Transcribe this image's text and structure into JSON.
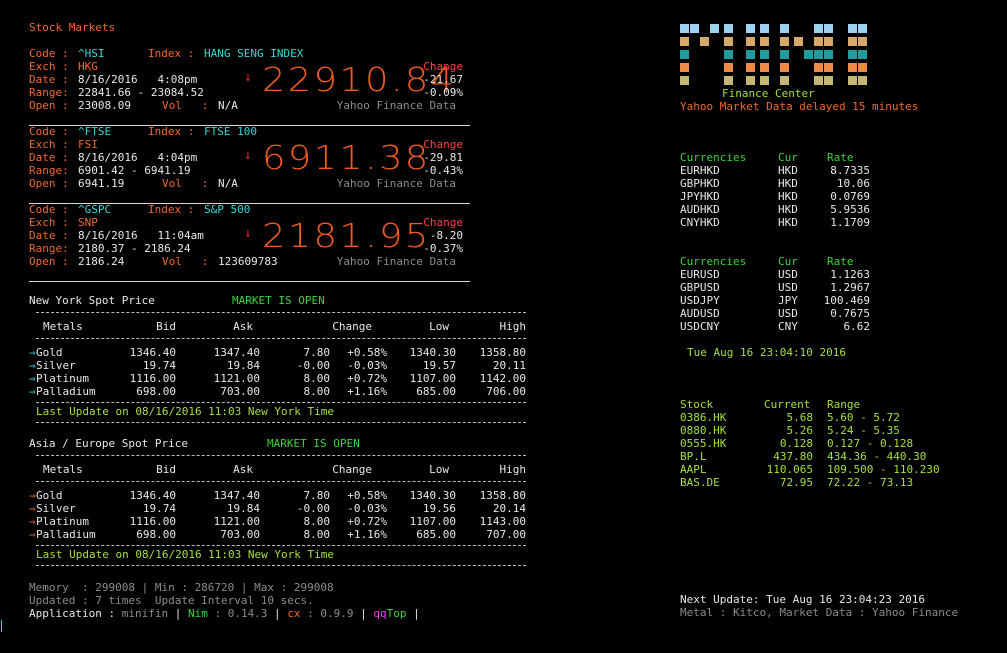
{
  "title": "Stock Markets",
  "indices": [
    {
      "code": "^HSI",
      "index": "HANG SENG INDEX",
      "exch": "HKG",
      "date": "8/16/2016   4:08pm",
      "range": "22841.66 - 23084.52",
      "open": "23008.09",
      "vol": "N/A",
      "change_label": "Change",
      "change": "-21.67",
      "change_pct": "-0.09%",
      "price": "22910.84",
      "source": "Yahoo Finance Data"
    },
    {
      "code": "^FTSE",
      "index": "FTSE 100",
      "exch": "FSI",
      "date": "8/16/2016   4:04pm",
      "range": "6901.42 - 6941.19",
      "open": "6941.19",
      "vol": "N/A",
      "change_label": "Change",
      "change": "-29.81",
      "change_pct": "-0.43%",
      "price": "6911.38",
      "source": "Yahoo Finance Data"
    },
    {
      "code": "^GSPC",
      "index": "S&P 500",
      "exch": "SNP",
      "date": "8/16/2016   11:04am",
      "range": "2180.37 - 2186.24",
      "open": "2186.24",
      "vol": "123609783",
      "change_label": "Change",
      "change": "-8.20",
      "change_pct": "-0.37%",
      "price": "2181.95",
      "source": "Yahoo Finance Data"
    }
  ],
  "labels": {
    "code": "Code : ",
    "index": "Index : ",
    "exch": "Exch : ",
    "date": "Date : ",
    "range": "Range: ",
    "open": "Open : ",
    "vol": "Vol   : ",
    "arrow": "↓"
  },
  "metals_header": [
    "Metals",
    "Bid",
    "Ask",
    "Change",
    "Low",
    "High"
  ],
  "ny": {
    "title": "New York Spot Price",
    "status": "MARKET IS OPEN",
    "rows": [
      [
        "Gold",
        "1346.40",
        "1347.40",
        "7.80",
        "+0.58%",
        "1340.30",
        "1358.80"
      ],
      [
        "Silver",
        "19.74",
        "19.84",
        "-0.00",
        "-0.03%",
        "19.57",
        "20.11"
      ],
      [
        "Platinum",
        "1116.00",
        "1121.00",
        "8.00",
        "+0.72%",
        "1107.00",
        "1142.00"
      ],
      [
        "Palladium",
        "698.00",
        "703.00",
        "8.00",
        "+1.16%",
        "685.00",
        "706.00"
      ]
    ],
    "update": "Last Update on 08/16/2016 11:03 New York Time"
  },
  "asia": {
    "title": "Asia / Europe Spot Price",
    "status": "MARKET IS OPEN",
    "rows": [
      [
        "Gold",
        "1346.40",
        "1347.40",
        "7.80",
        "+0.58%",
        "1340.30",
        "1358.80"
      ],
      [
        "Silver",
        "19.74",
        "19.84",
        "-0.00",
        "-0.03%",
        "19.56",
        "20.14"
      ],
      [
        "Platinum",
        "1116.00",
        "1121.00",
        "8.00",
        "+0.72%",
        "1107.00",
        "1143.00"
      ],
      [
        "Palladium",
        "698.00",
        "703.00",
        "8.00",
        "+1.16%",
        "685.00",
        "707.00"
      ]
    ],
    "update": "Last Update on 08/16/2016 11:03 New York Time"
  },
  "footer": {
    "memory": "Memory  : 299008 | Min : 286720 | Max : 299008",
    "updated": "Updated : 7 times  Update Interval 10 secs.",
    "app_label": "Application : ",
    "app_name": "minifin",
    "sep": " | ",
    "nim_label": "Nim",
    "nim_ver": " : 0.14.3",
    "cx_label": "cx",
    "cx_ver": " : 0.9.9",
    "qq": "qqTop",
    "tail": " |"
  },
  "right": {
    "finance_center": "Finance Center",
    "delay": "Yahoo Market Data delayed 15 minutes",
    "cur_headers": [
      "Currencies",
      "Cur",
      "Rate"
    ],
    "hkd": [
      [
        "EURHKD",
        "HKD",
        "8.7335"
      ],
      [
        "GBPHKD",
        "HKD",
        "10.06"
      ],
      [
        "JPYHKD",
        "HKD",
        "0.0769"
      ],
      [
        "AUDHKD",
        "HKD",
        "5.9536"
      ],
      [
        "CNYHKD",
        "HKD",
        "1.1709"
      ]
    ],
    "usd": [
      [
        "EURUSD",
        "USD",
        "1.1263"
      ],
      [
        "GBPUSD",
        "USD",
        "1.2967"
      ],
      [
        "USDJPY",
        "JPY",
        "100.469"
      ],
      [
        "AUDUSD",
        "USD",
        "0.7675"
      ],
      [
        "USDCNY",
        "CNY",
        "6.62"
      ]
    ],
    "datetime": "Tue Aug 16 23:04:10 2016",
    "stock_headers": [
      "Stock",
      "Current",
      "Range"
    ],
    "stocks": [
      [
        "0386.HK",
        "5.68",
        "5.60 - 5.72"
      ],
      [
        "0880.HK",
        "5.26",
        "5.24 - 5.35"
      ],
      [
        "0555.HK",
        "0.128",
        "0.127 - 0.128"
      ],
      [
        "BP.L",
        "437.80",
        "434.36 - 440.30"
      ],
      [
        "AAPL",
        "110.065",
        "109.500 - 110.230"
      ],
      [
        "BAS.DE",
        "72.95",
        "72.22 - 73.13"
      ]
    ],
    "next_update": "Next Update: Tue Aug 16 23:04:23 2016",
    "sources": "Metal : Kitco, Market Data : Yahoo Finance"
  },
  "colors": {
    "orange": "#f06a2a",
    "cyan": "#3ad7d7",
    "green": "#3bd33b",
    "lime": "#a6e03a",
    "red": "#ff4040"
  }
}
